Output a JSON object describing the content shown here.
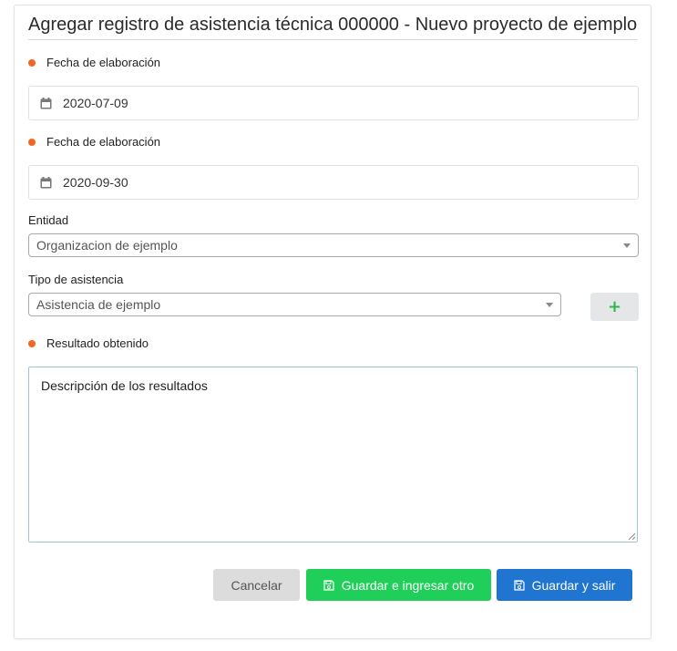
{
  "form": {
    "title": "Agregar registro de asistencia técnica 000000 - Nuevo proyecto de ejemplo",
    "fecha_inicio": {
      "label": "Fecha de elaboración",
      "value": "2020-07-09",
      "required": true
    },
    "fecha_fin": {
      "label": "Fecha de elaboración",
      "value": "2020-09-30",
      "required": true
    },
    "entidad": {
      "label": "Entidad",
      "value": "Organizacion de ejemplo"
    },
    "tipo_asistencia": {
      "label": "Tipo de asistencia",
      "value": "Asistencia de ejemplo",
      "add_label": "+"
    },
    "resultado": {
      "label": "Resultado obtenido",
      "value": "Descripción de los resultados",
      "required": true
    }
  },
  "buttons": {
    "cancel": "Cancelar",
    "save_and_new": "Guardar e ingresar otro",
    "save_and_exit": "Guardar y salir"
  },
  "colors": {
    "required_dot": "#f26522",
    "save_and_new": "#1fcf5a",
    "save_and_exit": "#1f75cf",
    "cancel": "#dcdcdc",
    "add_plus": "#2fb84a"
  },
  "icons": {
    "date": "calendar-icon",
    "save": "floppy-disk-icon",
    "add": "plus-icon",
    "dropdown": "caret-down-icon"
  }
}
